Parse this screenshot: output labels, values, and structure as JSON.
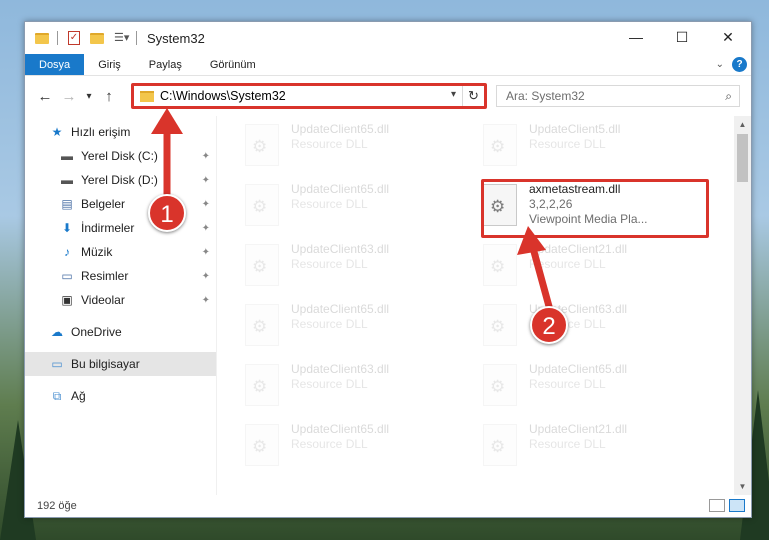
{
  "window": {
    "title": "System32",
    "controls": {
      "minimize": "—",
      "maximize": "☐",
      "close": "✕"
    }
  },
  "ribbon": {
    "tabs": [
      "Dosya",
      "Giriş",
      "Paylaş",
      "Görünüm"
    ],
    "expand_icon": "chevron-down-icon",
    "help": "?"
  },
  "nav": {
    "back": "←",
    "forward": "→",
    "recent": "▾",
    "up": "↑",
    "address": "C:\\Windows\\System32",
    "dropdown": "▾",
    "refresh": "↻",
    "search_placeholder": "Ara: System32",
    "search_icon": "⌕"
  },
  "sidebar": {
    "quick_access": "Hızlı erişim",
    "items": [
      {
        "label": "Yerel Disk (C:)",
        "icon": "drive-icon",
        "glyph": "▬"
      },
      {
        "label": "Yerel Disk (D:)",
        "icon": "drive-icon",
        "glyph": "▬"
      },
      {
        "label": "Belgeler",
        "icon": "documents-icon",
        "glyph": "▤"
      },
      {
        "label": "İndirmeler",
        "icon": "downloads-icon",
        "glyph": "⬇"
      },
      {
        "label": "Müzik",
        "icon": "music-icon",
        "glyph": "♪"
      },
      {
        "label": "Resimler",
        "icon": "pictures-icon",
        "glyph": "▭"
      },
      {
        "label": "Videolar",
        "icon": "videos-icon",
        "glyph": "▣"
      }
    ],
    "onedrive": "OneDrive",
    "this_pc": "Bu bilgisayar",
    "network": "Ağ",
    "pin_glyph": "📌"
  },
  "files": {
    "left_col": [
      {
        "name": "UpdateClient65.dll",
        "sub": "Resource DLL"
      },
      {
        "name": "UpdateClient65.dll",
        "sub": "Resource DLL"
      },
      {
        "name": "UpdateClient63.dll",
        "sub": "Resource DLL"
      },
      {
        "name": "UpdateClient65.dll",
        "sub": "Resource DLL"
      },
      {
        "name": "UpdateClient63.dll",
        "sub": "Resource DLL"
      },
      {
        "name": "UpdateClient65.dll",
        "sub": "Resource DLL"
      }
    ],
    "right_col": [
      {
        "name": "UpdateClient5.dll",
        "sub": "Resource DLL"
      },
      {
        "name": "axmetastream.dll",
        "version": "3,2,2,26",
        "sub": "Viewpoint Media Pla..."
      },
      {
        "name": "UpdateClient21.dll",
        "sub": "Resource DLL"
      },
      {
        "name": "UpdateClient63.dll",
        "sub": "Resource DLL"
      },
      {
        "name": "UpdateClient65.dll",
        "sub": "Resource DLL"
      },
      {
        "name": "UpdateClient21.dll",
        "sub": "Resource DLL"
      }
    ]
  },
  "status": {
    "count": "192 öğe"
  },
  "annotations": {
    "badge1": "1",
    "badge2": "2",
    "color": "#d9342b"
  }
}
